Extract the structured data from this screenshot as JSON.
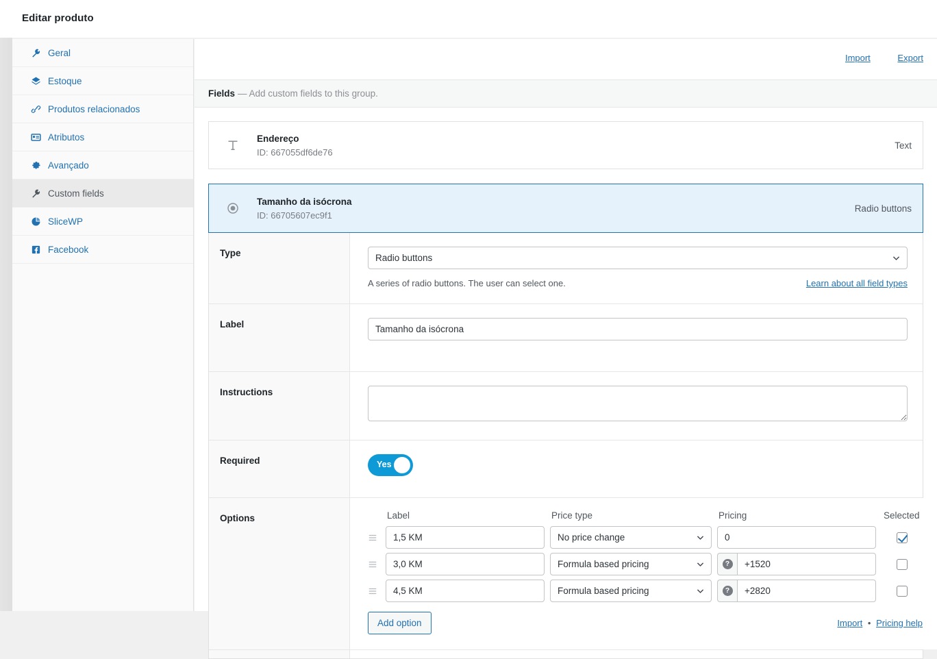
{
  "window": {
    "title": "Editar produto"
  },
  "sidebar": {
    "items": [
      {
        "label": "Geral",
        "icon": "wrench-icon",
        "active": false
      },
      {
        "label": "Estoque",
        "icon": "cube-icon",
        "active": false
      },
      {
        "label": "Produtos relacionados",
        "icon": "link-icon",
        "active": false
      },
      {
        "label": "Atributos",
        "icon": "form-icon",
        "active": false
      },
      {
        "label": "Avançado",
        "icon": "gear-icon",
        "active": false
      },
      {
        "label": "Custom fields",
        "icon": "wrench-icon",
        "active": true
      },
      {
        "label": "SliceWP",
        "icon": "pie-chart-icon",
        "active": false
      },
      {
        "label": "Facebook",
        "icon": "facebook-icon",
        "active": false
      }
    ]
  },
  "header": {
    "import_label": "Import",
    "export_label": "Export"
  },
  "fields_bar": {
    "title": "Fields",
    "description": "— Add custom fields to this group."
  },
  "fields": [
    {
      "name": "Endereço",
      "id_text": "ID: 667055df6de76",
      "type_label": "Text",
      "icon": "text-field-icon",
      "open": false
    },
    {
      "name": "Tamanho da isócrona",
      "id_text": "ID: 66705607ec9f1",
      "type_label": "Radio buttons",
      "icon": "radio-button-icon",
      "open": true
    }
  ],
  "settings": {
    "type": {
      "label": "Type",
      "value": "Radio buttons",
      "description": "A series of radio buttons. The user can select one.",
      "help_link": "Learn about all field types"
    },
    "field_label": {
      "label": "Label",
      "value": "Tamanho da isócrona"
    },
    "instructions": {
      "label": "Instructions",
      "value": ""
    },
    "required": {
      "label": "Required",
      "toggle_text": "Yes",
      "toggle_on": true,
      "accent": "#0d9ad6"
    },
    "options": {
      "label": "Options",
      "columns": [
        "Label",
        "Price type",
        "Pricing",
        "Selected"
      ],
      "rows": [
        {
          "label": "1,5 KM",
          "price_type": "No price change",
          "pricing": "0",
          "has_help_icon": false,
          "selected": true
        },
        {
          "label": "3,0 KM",
          "price_type": "Formula based pricing",
          "pricing": "+1520",
          "has_help_icon": true,
          "selected": false
        },
        {
          "label": "4,5 KM",
          "price_type": "Formula based pricing",
          "pricing": "+2820",
          "has_help_icon": true,
          "selected": false
        }
      ],
      "add_option_label": "Add option",
      "import_label": "Import",
      "separator": "•",
      "pricing_help_label": "Pricing help"
    }
  }
}
